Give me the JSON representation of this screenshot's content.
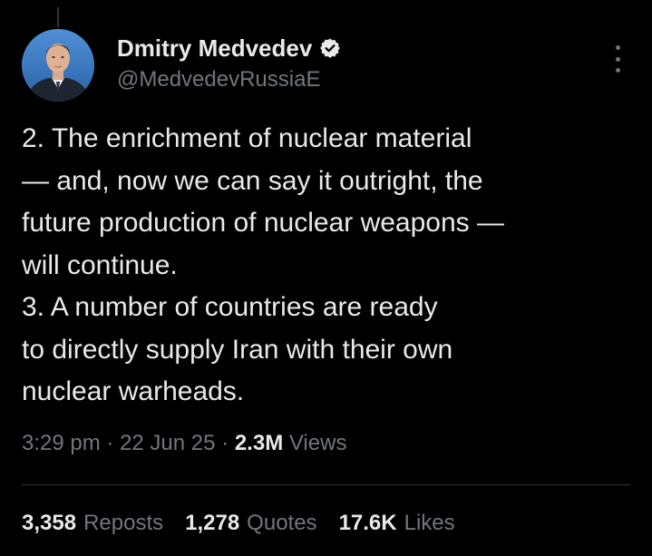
{
  "author": {
    "display_name": "Dmitry Medvedev",
    "handle": "@MedvedevRussiaE",
    "verified_badge_color": "#1d9bf0"
  },
  "tweet": {
    "lines": [
      "2. The enrichment of nuclear material",
      "— and, now we can say it outright, the",
      "future production of nuclear weapons —",
      "will continue.",
      "3. A number of countries are ready",
      "to directly supply Iran with their own",
      "nuclear warheads."
    ]
  },
  "meta": {
    "time": "3:29 pm",
    "separator": "·",
    "date": "22 Jun 25",
    "views_count": "2.3M",
    "views_label": "Views"
  },
  "stats": {
    "reposts_count": "3,358",
    "reposts_label": "Reposts",
    "quotes_count": "1,278",
    "quotes_label": "Quotes",
    "likes_count": "17.6K",
    "likes_label": "Likes"
  },
  "icons": {
    "verified": "verified-badge-icon",
    "more": "more-options-icon"
  },
  "colors": {
    "background": "#000000",
    "text_primary": "#e7e9ea",
    "text_secondary": "#71767b",
    "divider": "#2f3336"
  }
}
